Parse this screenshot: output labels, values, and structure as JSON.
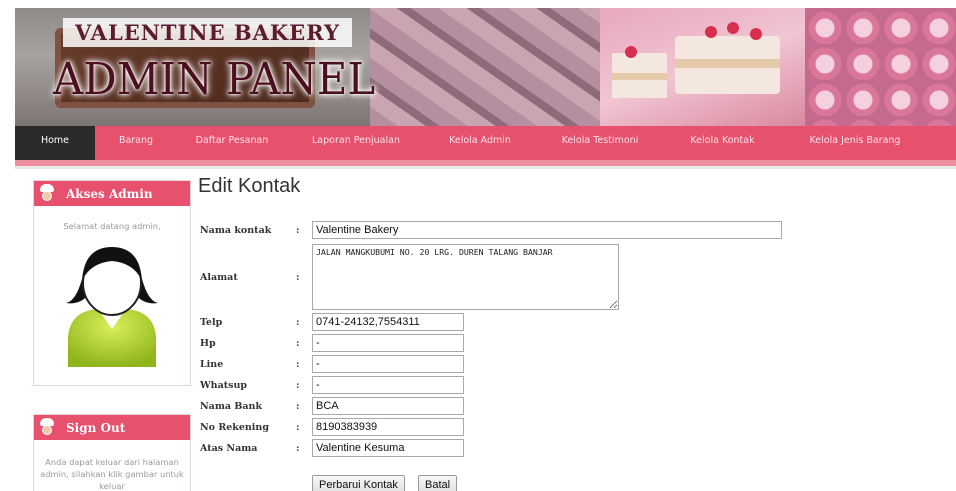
{
  "banner": {
    "brand_top": "VALENTINE BAKERY",
    "brand_main": "ADMIN PANEL"
  },
  "nav": {
    "items": [
      {
        "label": "Home",
        "active": true
      },
      {
        "label": "Barang",
        "active": false
      },
      {
        "label": "Daftar Pesanan",
        "active": false
      },
      {
        "label": "Laporan Penjualan",
        "active": false
      },
      {
        "label": "Kelola Admin",
        "active": false
      },
      {
        "label": "Kelola Testimoni",
        "active": false
      },
      {
        "label": "Kelola Kontak",
        "active": false
      },
      {
        "label": "Kelola Jenis Barang",
        "active": false
      }
    ]
  },
  "sidebar": {
    "akses": {
      "title": "Akses Admin",
      "welcome": "Selamat datang admin,"
    },
    "signout": {
      "title": "Sign Out",
      "text": "Anda dapat keluar dari halaman admin, silahkan klik gambar untuk keluar"
    }
  },
  "form": {
    "title": "Edit Kontak",
    "fields": {
      "nama_kontak": {
        "label": "Nama kontak",
        "value": "Valentine Bakery"
      },
      "alamat": {
        "label": "Alamat",
        "value": "JALAN MANGKUBUMI NO. 20 LRG. DUREN TALANG BANJAR"
      },
      "telp": {
        "label": "Telp",
        "value": "0741-24132,7554311"
      },
      "hp": {
        "label": "Hp",
        "value": "-"
      },
      "line": {
        "label": "Line",
        "value": "-"
      },
      "whatsup": {
        "label": "Whatsup",
        "value": "-"
      },
      "nama_bank": {
        "label": "Nama Bank",
        "value": "BCA"
      },
      "no_rekening": {
        "label": "No Rekening",
        "value": "8190383939"
      },
      "atas_nama": {
        "label": "Atas Nama",
        "value": "Valentine Kesuma"
      }
    },
    "colon": ":",
    "buttons": {
      "update": "Perbarui Kontak",
      "cancel": "Batal"
    }
  },
  "colors": {
    "accent": "#e8516d",
    "nav_active": "#2b2b2b",
    "nav_text": "#ffe2e8"
  }
}
